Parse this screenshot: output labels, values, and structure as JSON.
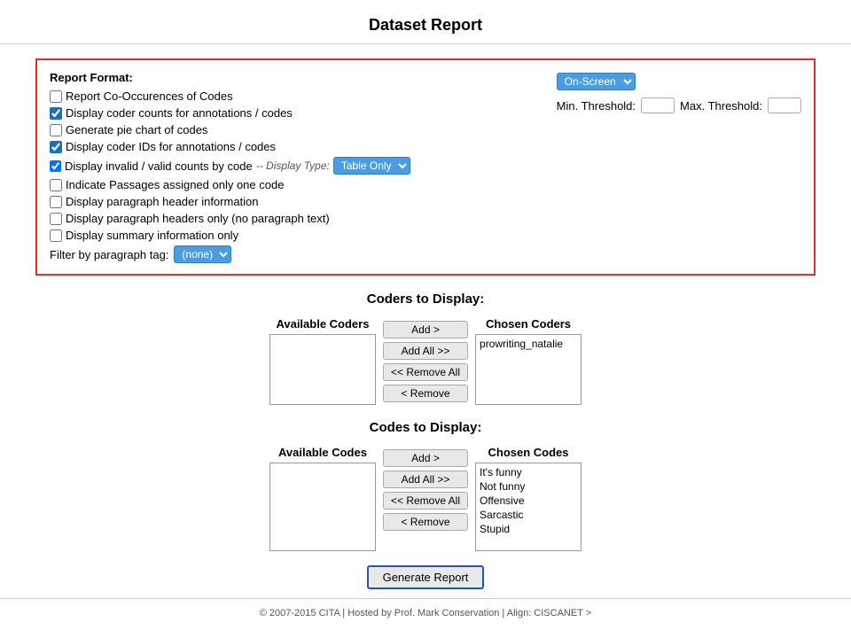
{
  "page": {
    "title": "Dataset Report"
  },
  "report_format": {
    "label": "Report Format:",
    "checkboxes": [
      {
        "id": "cb1",
        "label": "Report Co-Occurences of Codes",
        "checked": false
      },
      {
        "id": "cb2",
        "label": "Display coder counts for annotations / codes",
        "checked": true
      },
      {
        "id": "cb3",
        "label": "Generate pie chart of codes",
        "checked": false
      },
      {
        "id": "cb4",
        "label": "Display coder IDs for annotations / codes",
        "checked": true
      },
      {
        "id": "cb5",
        "label": "Display invalid / valid counts by code",
        "checked": true
      }
    ],
    "display_type_label": "-- Display Type:",
    "display_type_value": "Table Only",
    "more_checkboxes": [
      {
        "id": "cb6",
        "label": "Indicate Passages assigned only one code",
        "checked": false
      },
      {
        "id": "cb7",
        "label": "Display paragraph header information",
        "checked": false
      },
      {
        "id": "cb8",
        "label": "Display paragraph headers only (no paragraph text)",
        "checked": false
      },
      {
        "id": "cb9",
        "label": "Display summary information only",
        "checked": false
      }
    ],
    "filter_label": "Filter by paragraph tag:",
    "filter_value": "(none)",
    "on_screen_label": "On-Screen",
    "min_threshold_label": "Min. Threshold:",
    "max_threshold_label": "Max. Threshold:"
  },
  "coders_section": {
    "title": "Coders to Display:",
    "available_label": "Available Coders",
    "chosen_label": "Chosen Coders",
    "buttons": {
      "add": "Add >",
      "add_all": "Add All >>",
      "remove_all": "<< Remove All",
      "remove": "< Remove"
    },
    "chosen_items": [
      "prowriting_natalie"
    ]
  },
  "codes_section": {
    "title": "Codes to Display:",
    "available_label": "Available Codes",
    "chosen_label": "Chosen Codes",
    "buttons": {
      "add": "Add >",
      "add_all": "Add All >>",
      "remove_all": "<< Remove All",
      "remove": "< Remove"
    },
    "chosen_items": [
      "It's funny",
      "Not funny",
      "Offensive",
      "Sarcastic",
      "Stupid"
    ],
    "generate_btn": "Generate Report"
  },
  "footer": {
    "text": "© 2007-2015  CITA  |  Hosted by  Prof. Mark Conservation  |  Align: CISCANET  >"
  }
}
